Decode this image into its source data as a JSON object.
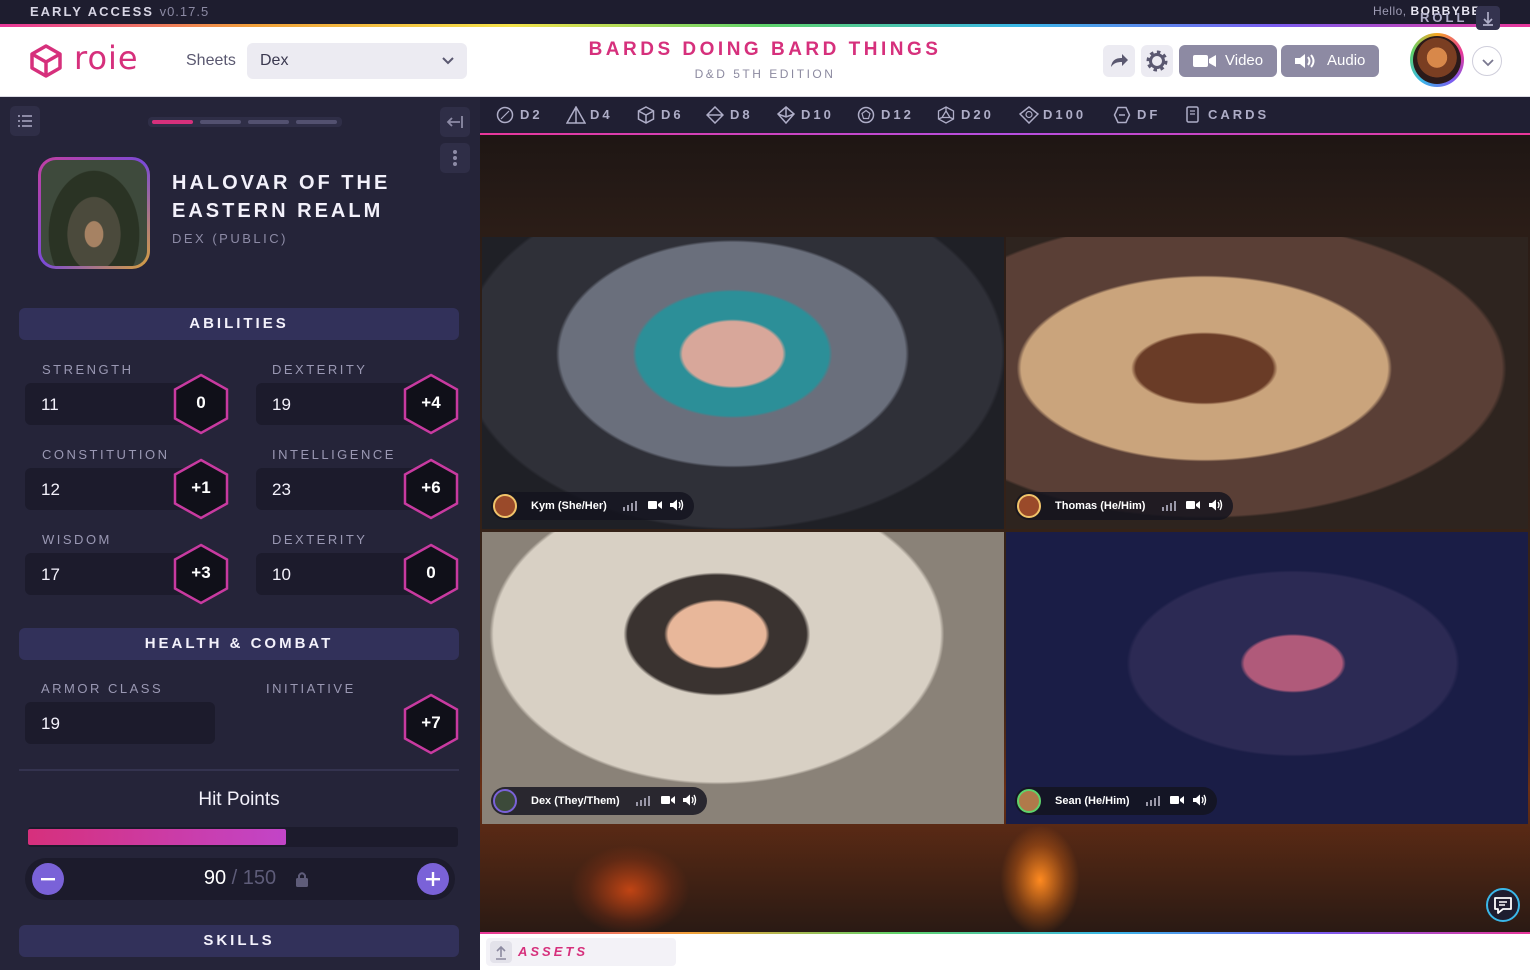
{
  "topstrip": {
    "early_access": "EARLY ACCESS",
    "version": "v0.17.5",
    "hello": "Hello,",
    "username": "BOBBYBEEP"
  },
  "header": {
    "logo_text": "roie",
    "sheets_label": "Sheets",
    "sheet_selected": "Dex",
    "game_title": "BARDS DOING BARD THINGS",
    "game_subtitle": "D&D 5TH EDITION",
    "video_label": "Video",
    "audio_label": "Audio",
    "icons": [
      "share-icon",
      "gear-icon",
      "video-camera-icon",
      "speaker-icon",
      "chevron-down-icon"
    ]
  },
  "character": {
    "name": "HALOVAR OF THE EASTERN REALM",
    "subtitle": "DEX (PUBLIC)",
    "sections": {
      "abilities": "ABILITIES",
      "health": "HEALTH & COMBAT",
      "skills": "SKILLS"
    },
    "abilities": [
      {
        "label": "STRENGTH",
        "value": "11",
        "mod": "0"
      },
      {
        "label": "DEXTERITY",
        "value": "19",
        "mod": "+4"
      },
      {
        "label": "CONSTITUTION",
        "value": "12",
        "mod": "+1"
      },
      {
        "label": "INTELLIGENCE",
        "value": "23",
        "mod": "+6"
      },
      {
        "label": "WISDOM",
        "value": "17",
        "mod": "+3"
      },
      {
        "label": "DEXTERITY",
        "value": "10",
        "mod": "0"
      }
    ],
    "combat": {
      "armor_class_label": "ARMOR CLASS",
      "armor_class": "19",
      "initiative_label": "INITIATIVE",
      "initiative": "+7"
    },
    "hit_points": {
      "title": "Hit Points",
      "current": "90",
      "separator": "/",
      "max": "150",
      "fraction": 0.6
    }
  },
  "dice": {
    "items": [
      {
        "label": "D2",
        "icon": "d2-icon"
      },
      {
        "label": "D4",
        "icon": "d4-icon"
      },
      {
        "label": "D6",
        "icon": "d6-icon"
      },
      {
        "label": "D8",
        "icon": "d8-icon"
      },
      {
        "label": "D10",
        "icon": "d10-icon"
      },
      {
        "label": "D12",
        "icon": "d12-icon"
      },
      {
        "label": "D20",
        "icon": "d20-icon"
      },
      {
        "label": "D100",
        "icon": "d100-icon"
      },
      {
        "label": "DF",
        "icon": "fudge-die-icon"
      },
      {
        "label": "CARDS",
        "icon": "cards-icon"
      }
    ],
    "roll_label": "ROLL"
  },
  "video": {
    "participants": [
      {
        "name": "Kym (She/Her)"
      },
      {
        "name": "Thomas (He/Him)"
      },
      {
        "name": "Dex (They/Them)"
      },
      {
        "name": "Sean (He/Him)"
      }
    ]
  },
  "assets": {
    "label": "ASSETS"
  },
  "colors": {
    "accent": "#d6307c",
    "purple": "#7a62d8",
    "sidebar": "#252439",
    "panel": "#32315a"
  }
}
